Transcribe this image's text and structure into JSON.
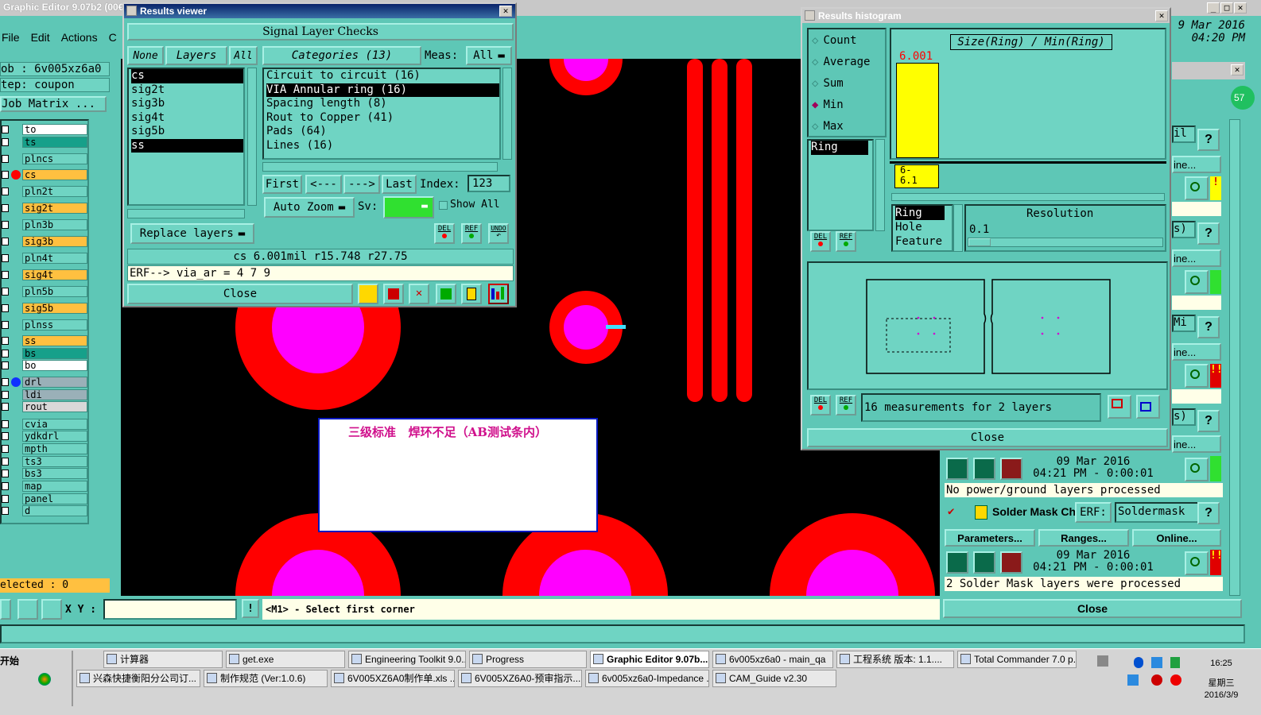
{
  "app": {
    "title": "Graphic Editor 9.07b2 (00€",
    "datetime_line1": "9 Mar 2016",
    "datetime_line2": "04:20 PM",
    "menu": [
      "File",
      "Edit",
      "Actions",
      "C"
    ]
  },
  "left_panel": {
    "job": "ob : 6v005xz6a0",
    "step": "tep: coupon",
    "job_matrix": "Job Matrix ...",
    "layers": [
      {
        "name": "to",
        "color": "#ffffff"
      },
      {
        "name": "ts",
        "color": "#16a08a"
      },
      {
        "name": "plncs",
        "color": "#6fd4c3"
      },
      {
        "name": "cs",
        "color": "#ffc040",
        "active": true
      },
      {
        "name": "pln2t",
        "color": "#6fd4c3"
      },
      {
        "name": "sig2t",
        "color": "#ffc040"
      },
      {
        "name": "pln3b",
        "color": "#6fd4c3"
      },
      {
        "name": "sig3b",
        "color": "#ffc040"
      },
      {
        "name": "pln4t",
        "color": "#6fd4c3"
      },
      {
        "name": "sig4t",
        "color": "#ffc040"
      },
      {
        "name": "pln5b",
        "color": "#6fd4c3"
      },
      {
        "name": "sig5b",
        "color": "#ffc040"
      },
      {
        "name": "plnss",
        "color": "#6fd4c3"
      },
      {
        "name": "ss",
        "color": "#ffc040"
      },
      {
        "name": "bs",
        "color": "#16a08a"
      },
      {
        "name": "bo",
        "color": "#ffffff"
      },
      {
        "name": "drl",
        "color": "#9ab0b8",
        "blue": true
      },
      {
        "name": "ldi",
        "color": "#9ab0b8"
      },
      {
        "name": "rout",
        "color": "#d8d8d8"
      },
      {
        "name": "cvia",
        "color": "#6fd4c3"
      },
      {
        "name": "ydkdrl",
        "color": "#6fd4c3"
      },
      {
        "name": "mpth",
        "color": "#6fd4c3"
      },
      {
        "name": "ts3",
        "color": "#6fd4c3"
      },
      {
        "name": "bs3",
        "color": "#6fd4c3"
      },
      {
        "name": "map",
        "color": "#6fd4c3"
      },
      {
        "name": "panel",
        "color": "#6fd4c3"
      },
      {
        "name": "d",
        "color": "#6fd4c3"
      }
    ],
    "selected": "elected : 0"
  },
  "results_viewer": {
    "title": "Results viewer",
    "header": "Signal Layer Checks",
    "none_label": "None",
    "layers_label": "Layers",
    "all_label": "All",
    "layer_list": [
      "cs",
      "sig2t",
      "sig3b",
      "sig4t",
      "sig5b",
      "ss"
    ],
    "categories_label": "Categories (13)",
    "meas_label": "Meas:",
    "meas_value": "All",
    "categories": [
      "Circuit to circuit (16)",
      "VIA Annular ring (16)",
      "Spacing length (8)",
      "Rout to Copper (41)",
      "Pads (64)",
      "Lines (16)"
    ],
    "first": "First",
    "prev": "<---",
    "next": "--->",
    "last": "Last",
    "index_label": "Index:",
    "index_value": "123",
    "auto_zoom": "Auto Zoom",
    "sv_label": "Sv:",
    "show_all": "Show All",
    "replace_layers": "Replace layers",
    "status": "cs 6.001mil  r15.748  r27.75",
    "erf": "ERF--> via_ar = 4 7 9",
    "close": "Close",
    "del": "DEL",
    "ref": "REF",
    "undo": "UNDO"
  },
  "histogram": {
    "title": "Results histogram",
    "options": [
      "Count",
      "Average",
      "Sum",
      "Min",
      "Max"
    ],
    "selected_option": "Min",
    "chart_title": "Size(Ring) / Min(Ring)",
    "bar_value": "6.001",
    "bin_label_1": "6-",
    "bin_label_2": "6.1",
    "ring_list": [
      "Ring"
    ],
    "feature_list": [
      "Ring",
      "Hole",
      "Feature"
    ],
    "resolution_label": "Resolution",
    "resolution_value": "0.1",
    "measurements": "16 measurements for 2 layers",
    "close": "Close",
    "del": "DEL",
    "ref": "REF"
  },
  "right_panel": {
    "mil1": "il",
    "line1": "ine...",
    "s1": "s)",
    "line2": "ine...",
    "mi": "Mi",
    "line3": "ine...",
    "s2": "s)",
    "line4": "ine...",
    "ts1_date": "09 Mar 2016",
    "ts1_time": "04:21 PM - 0:00:01",
    "msg1": "No power/ground layers processed",
    "solder_mask": "Solder Mask Ch",
    "erf": "ERF:",
    "erf_value": "Soldermask",
    "parameters": "Parameters...",
    "ranges": "Ranges...",
    "online": "Online...",
    "ts2_date": "09 Mar 2016",
    "ts2_time": "04:21 PM - 0:00:01",
    "msg2": "2 Solder Mask layers were processed",
    "close": "Close",
    "badge": "57"
  },
  "canvas": {
    "annotation": "三级标准   焊环不足（AB测试条内）"
  },
  "command_bar": {
    "xy_label": "X Y :",
    "xy_value": "",
    "prompt": "<M1> - Select first corner"
  },
  "taskbar": {
    "start": "开始",
    "row1": [
      "计算器",
      "get.exe",
      "Engineering Toolkit 9.0...",
      "Progress",
      "Graphic Editor 9.07b...",
      "6v005xz6a0 - main_qa",
      "工程系统  版本: 1.1....",
      "Total Commander 7.0 p..."
    ],
    "row2": [
      "兴森快捷衡阳分公司订...",
      "制作规范 (Ver:1.0.6)",
      "6V005XZ6A0制作单.xls ...",
      "6V005XZ6A0-预审指示....",
      "6v005xz6a0-Impedance ...",
      "CAM_Guide v2.30"
    ],
    "time": "16:25",
    "weekday": "星期三",
    "date": "2016/3/9"
  }
}
